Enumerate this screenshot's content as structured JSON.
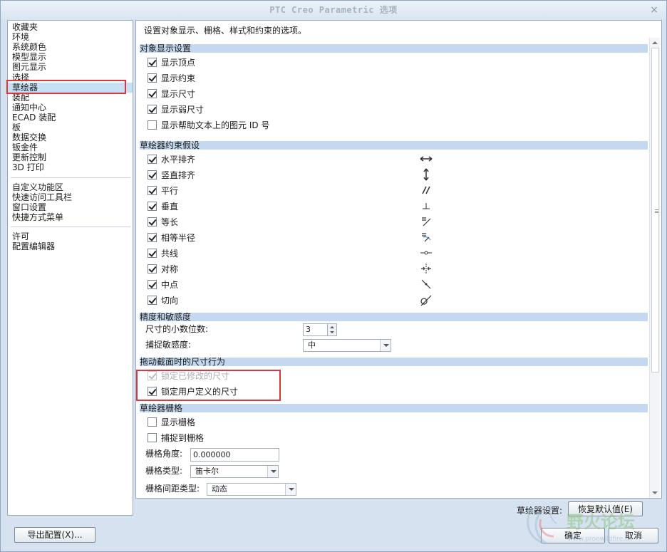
{
  "window": {
    "title": "PTC Creo Parametric 选项",
    "close_glyph": "×"
  },
  "sidebar": {
    "groups": [
      [
        "收藏夹",
        "环境",
        "系统颜色",
        "模型显示",
        "图元显示",
        "选择",
        "草绘器",
        "装配",
        "通知中心",
        "ECAD 装配",
        "板",
        "数据交换",
        "钣金件",
        "更新控制",
        "3D 打印"
      ],
      [
        "自定义功能区",
        "快速访问工具栏",
        "窗口设置",
        "快捷方式菜单"
      ],
      [
        "许可",
        "配置编辑器"
      ]
    ],
    "selected": "草绘器"
  },
  "main": {
    "description": "设置对象显示、栅格、样式和约束的选项。",
    "sections": {
      "display": {
        "title": "对象显示设置",
        "items": [
          {
            "label": "显示顶点",
            "checked": true
          },
          {
            "label": "显示约束",
            "checked": true
          },
          {
            "label": "显示尺寸",
            "checked": true
          },
          {
            "label": "显示弱尺寸",
            "checked": true
          },
          {
            "label": "显示帮助文本上的图元 ID 号",
            "checked": false
          }
        ]
      },
      "constraints": {
        "title": "草绘器约束假设",
        "items": [
          {
            "label": "水平排齐",
            "checked": true,
            "icon": "horizontal-icon"
          },
          {
            "label": "竖直排齐",
            "checked": true,
            "icon": "vertical-icon"
          },
          {
            "label": "平行",
            "checked": true,
            "icon": "parallel-icon"
          },
          {
            "label": "垂直",
            "checked": true,
            "icon": "perpendicular-icon"
          },
          {
            "label": "等长",
            "checked": true,
            "icon": "equal-length-icon"
          },
          {
            "label": "相等半径",
            "checked": true,
            "icon": "equal-radius-icon"
          },
          {
            "label": "共线",
            "checked": true,
            "icon": "collinear-icon"
          },
          {
            "label": "对称",
            "checked": true,
            "icon": "symmetric-icon"
          },
          {
            "label": "中点",
            "checked": true,
            "icon": "midpoint-icon"
          },
          {
            "label": "切向",
            "checked": true,
            "icon": "tangent-icon"
          }
        ]
      },
      "precision": {
        "title": "精度和敏感度",
        "decimals_label": "尺寸的小数位数:",
        "decimals_value": "3",
        "snap_label": "捕捉敏感度:",
        "snap_value": "中"
      },
      "drag": {
        "title": "拖动截面时的尺寸行为",
        "items": [
          {
            "label": "锁定已修改的尺寸",
            "checked": true,
            "disabled": true
          },
          {
            "label": "锁定用户定义的尺寸",
            "checked": true,
            "disabled": false
          }
        ]
      },
      "grid": {
        "title": "草绘器栅格",
        "show_grid_label": "显示栅格",
        "show_grid_checked": false,
        "snap_grid_label": "捕捉到栅格",
        "snap_grid_checked": false,
        "angle_label": "栅格角度:",
        "angle_value": "0.000000",
        "type_label": "栅格类型:",
        "type_value": "笛卡尔",
        "spacing_label": "栅格间距类型:",
        "spacing_value": "动态"
      }
    }
  },
  "footer": {
    "sketcher_settings_label": "草绘器设置:",
    "restore_defaults": "恢复默认值(E)",
    "export_config": "导出配置(X)...",
    "ok": "确定",
    "cancel": "取消"
  },
  "watermark": {
    "text": "野火论坛",
    "url": "www.proewildfire.cn"
  },
  "colors": {
    "section_header": "#c4d8ef",
    "selection": "#c9dff4",
    "highlight_box": "#d9363e",
    "window_bg": "#d6e2ef"
  }
}
